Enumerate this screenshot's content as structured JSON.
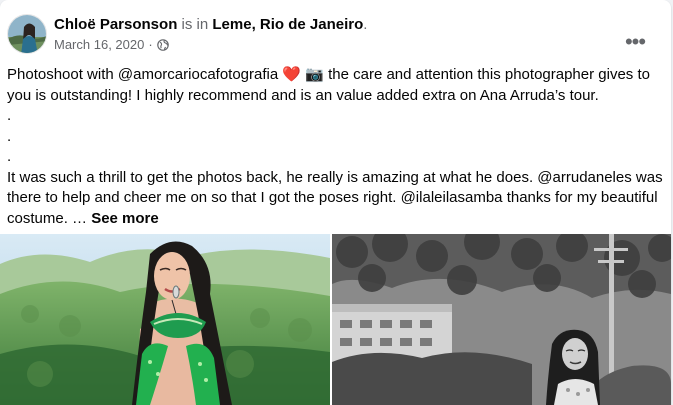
{
  "post": {
    "author": "Chloë Parsonson",
    "is_in": "is in",
    "location": "Leme, Rio de Janeiro",
    "period": ".",
    "date": "March 16, 2020",
    "dot": "·",
    "privacy_icon": "globe-icon",
    "more_icon": "more-options-icon",
    "more_label": "•••",
    "text_line1_a": "Photoshoot with @amorcariocafotografia ",
    "heart": "❤️",
    "camera": "📷",
    "text_line1_b": " the care and attention this photographer gives to you is outstanding! I highly recommend and is an value added extra on Ana Arruda’s tour.",
    "dot_line_1": ".",
    "dot_line_2": ".",
    "dot_line_3": ".",
    "text_line2": "It was such a thrill to get the photos back, he really is amazing at what he does. @arrudaneles was there to help and cheer me on so that I got the poses right.  @ilaleilasamba thanks for my beautiful costume. … ",
    "see_more": "See more"
  },
  "colors": {
    "text": "#050505",
    "muted": "#65676b",
    "card": "#ffffff",
    "background": "#f0f2f5",
    "heart": "#e0245e",
    "costume_green": "#2fbf5a"
  }
}
